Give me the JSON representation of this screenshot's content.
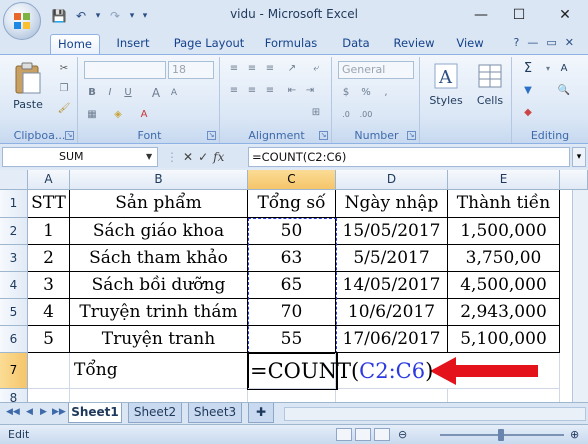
{
  "window": {
    "title": "vidu - Microsoft Excel",
    "minimize": "—",
    "restore": "☐",
    "close": "✕"
  },
  "qat": {
    "save": "💾",
    "undo": "↶",
    "undo_menu": "▾",
    "redo": "↷",
    "redo_menu": "▾",
    "customize": "▾"
  },
  "tabs": [
    "Home",
    "Insert",
    "Page Layout",
    "Formulas",
    "Data",
    "Review",
    "View"
  ],
  "ribbon": {
    "clipboard": {
      "label": "Clipboa...",
      "paste": "Paste"
    },
    "font": {
      "label": "Font",
      "font_name": "",
      "font_size": "18",
      "bold": "B",
      "italic": "I",
      "underline": "U",
      "grow": "A",
      "shrink": "A"
    },
    "alignment": {
      "label": "Alignment"
    },
    "number": {
      "label": "Number",
      "format": "General",
      "currency": "$",
      "percent": "%",
      "comma": ",",
      "inc": ".0",
      "dec": ".00"
    },
    "styles": {
      "label": "Styles"
    },
    "cells": {
      "label": "Cells"
    },
    "editing": {
      "label": "Editing",
      "sum": "Σ",
      "sort": "A",
      "fill": "▼"
    }
  },
  "formula_bar": {
    "name_box": "SUM",
    "cancel": "✕",
    "enter": "✓",
    "fx": "fx",
    "formula": "=COUNT(C2:C6)",
    "expand": "▾"
  },
  "columns": [
    "A",
    "B",
    "C",
    "D",
    "E"
  ],
  "rows": [
    "1",
    "2",
    "3",
    "4",
    "5",
    "6",
    "7",
    "8"
  ],
  "table": {
    "header": [
      "STT",
      "Sản phẩm",
      "Tổng số",
      "Ngày nhập",
      "Thành tiền"
    ],
    "data": [
      [
        "1",
        "Sách giáo khoa",
        "50",
        "15/05/2017",
        "1,500,000"
      ],
      [
        "2",
        "Sách tham khảo",
        "63",
        "5/5/2017",
        "3,750,00"
      ],
      [
        "3",
        "Sách bồi dưỡng",
        "65",
        "14/05/2017",
        "4,500,000"
      ],
      [
        "4",
        "Truyện trinh thám",
        "70",
        "10/6/2017",
        "2,943,000"
      ],
      [
        "5",
        "Truyện tranh",
        "55",
        "17/06/2017",
        "5,100,000"
      ]
    ],
    "total_label": "Tổng",
    "total_formula_prefix": "=COUNT(",
    "total_formula_range": "C2:C6",
    "total_formula_suffix": ")"
  },
  "sheets": [
    "Sheet1",
    "Sheet2",
    "Sheet3"
  ],
  "status": {
    "mode": "Edit"
  },
  "colors": {
    "arrow": "#e3121b",
    "range": "#2a3ae0",
    "selected_header": "#f5c56a"
  }
}
